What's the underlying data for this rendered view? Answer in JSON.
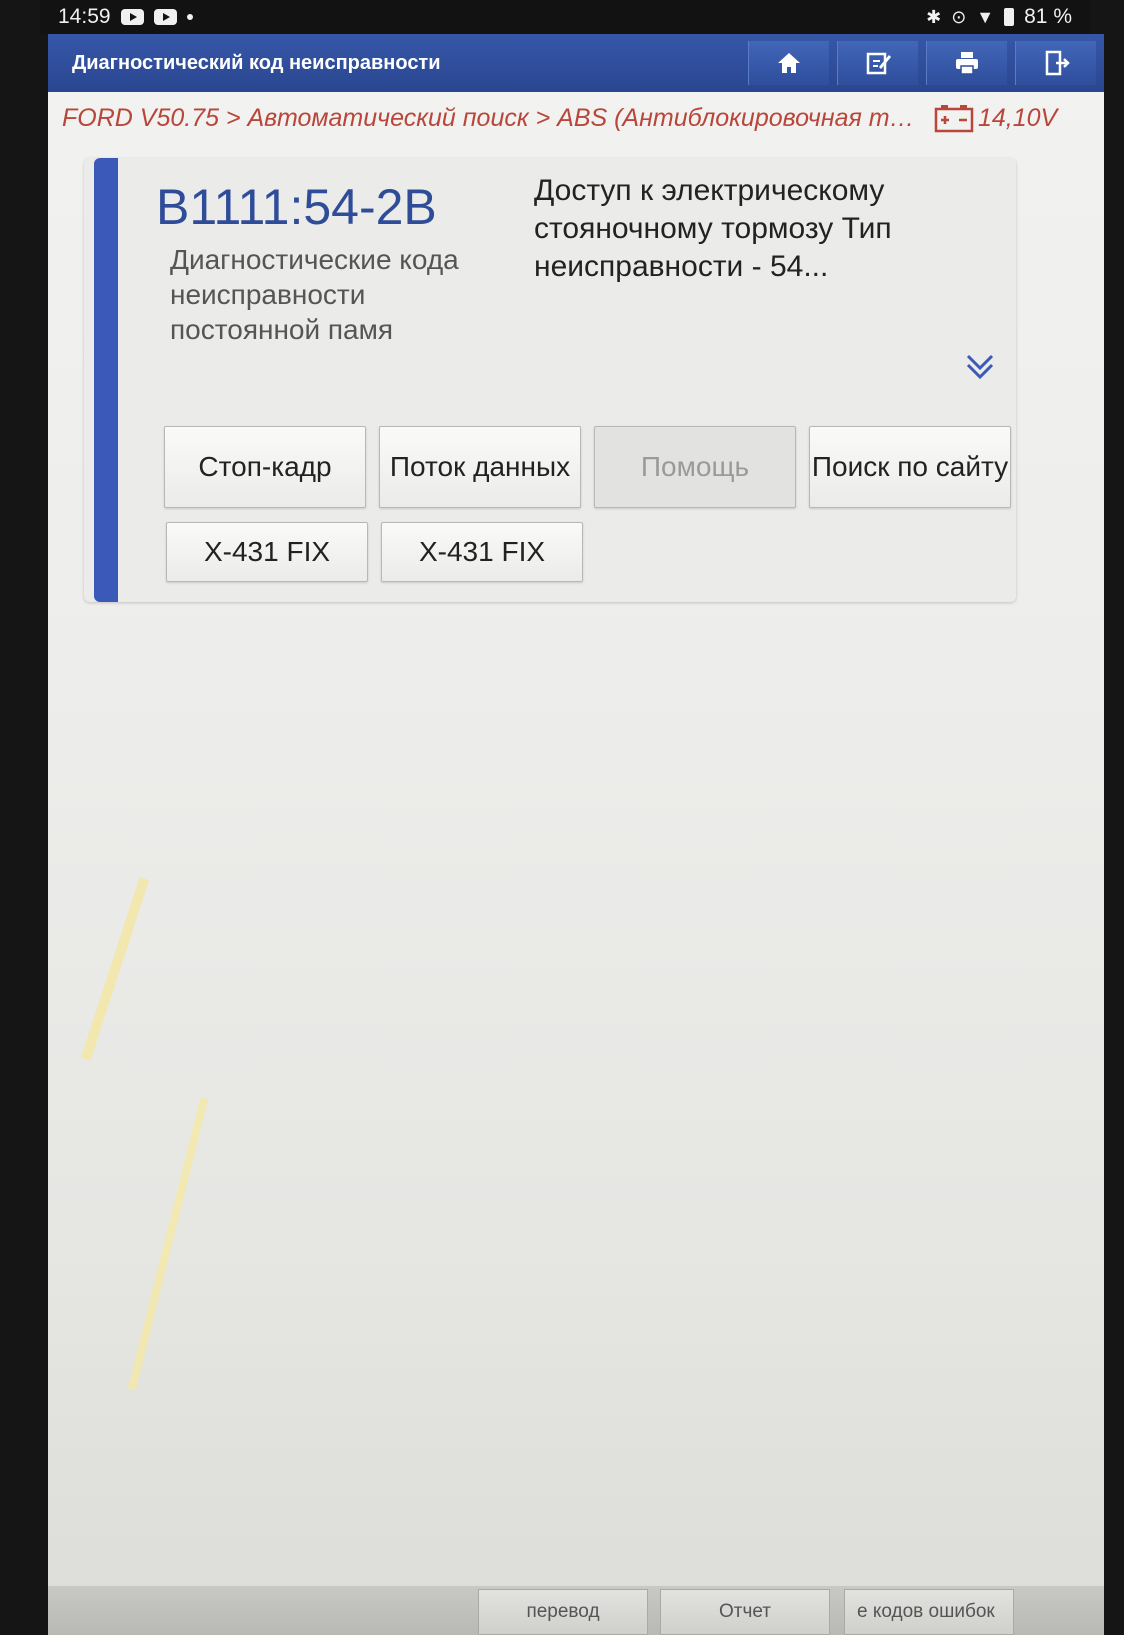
{
  "status_bar": {
    "time": "14:59",
    "battery": "81 %"
  },
  "app_bar": {
    "title": "Диагностический код неисправности",
    "tools": [
      "home-icon",
      "edit-icon",
      "print-icon",
      "exit-icon"
    ]
  },
  "breadcrumb": {
    "path": "FORD V50.75 > Автоматический поиск > ABS (Антиблокировочная тор...",
    "voltage": "14,10V"
  },
  "dtc": {
    "code": "B1111:54-2B",
    "type": "Диагностические кода неисправности постоянной памя",
    "description": "Доступ к электрическому стояночному тормозу Тип неисправности  - 54..."
  },
  "buttons": {
    "freeze_frame": "Стоп-кадр",
    "data_stream": "Поток данных",
    "help": "Помощь",
    "web_search": "Поиск по сайту",
    "fix1": "X-431 FIX",
    "fix2": "X-431 FIX"
  },
  "bottom_bar": {
    "translate": "перевод",
    "report": "Отчет",
    "clear_codes": "е кодов ошибок"
  },
  "colors": {
    "app_bar": "#2f4e9c",
    "breadcrumb": "#b8463a",
    "dtc_code": "#2f4c98",
    "card_accent": "#3b59b8"
  }
}
